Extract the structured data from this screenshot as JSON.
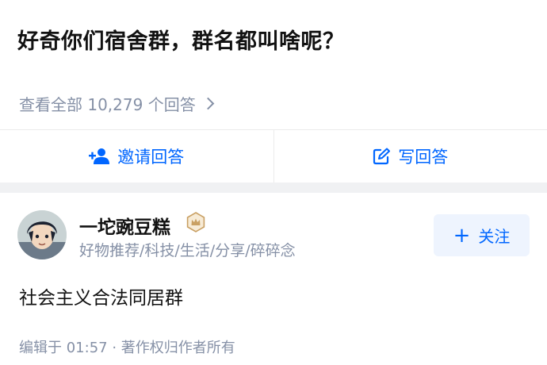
{
  "question": {
    "title": "好奇你们宿舍群，群名都叫啥呢？"
  },
  "view_all": {
    "label": "查看全部 10,279 个回答"
  },
  "actions": {
    "invite_label": "邀请回答",
    "write_label": "写回答"
  },
  "answer": {
    "author_name": "一坨豌豆糕",
    "author_bio": "好物推荐/科技/生活/分享/碎碎念",
    "follow_label": "关注",
    "content": "社会主义合法同居群",
    "meta": "编辑于 01:57 · 著作权归作者所有"
  },
  "icons": {
    "invite": "add-user-icon",
    "write": "edit-icon",
    "chevron": "chevron-right-icon",
    "badge": "crown-badge-icon"
  },
  "colors": {
    "accent": "#0066ff",
    "muted": "#8590a6",
    "follow_bg": "#eef4fe",
    "badge": "#c9a063"
  }
}
